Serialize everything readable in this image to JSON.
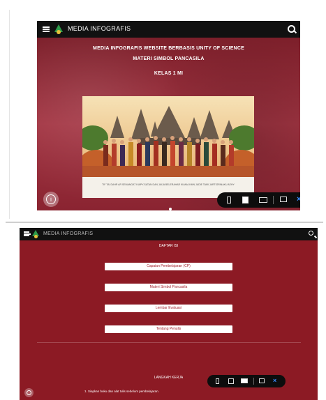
{
  "screen1": {
    "app_title": "MEDIA INFOGRAFIS",
    "headline_line1": "MEDIA INFOGRAFIS WEBSITE  BERBASIS UNITY OF SCIENCE",
    "headline_line2": "MATERI SIMBOL PANCASILA",
    "headline_line3": "KELAS 1 MI",
    "image_caption": "TIF TAI DAHR AR SEMANGAT KIAPY-SATAN DAN JAIJA BELERAHAR KIANIA KMN JADIE TAMI JARTIGRINAKU AEHY",
    "icons": {
      "menu": "hamburger-icon",
      "logo": "tree-logo-icon",
      "search": "search-icon",
      "info": "info-icon",
      "close": "close-icon"
    },
    "colors": {
      "background": "#8f2531",
      "topbar": "#111111",
      "close_accent": "#3b8cff"
    }
  },
  "screen2": {
    "app_title": "MEDIA INFOGRAFIS",
    "section_title": "DAFTAR ISI",
    "menu_items": [
      "Capaian Pembelajaran (CP)",
      "Materi Simbol Pancasila",
      "Lembar Evaluasi",
      "Tentang Penulis"
    ],
    "section2_title": "LANGKAH KERJA",
    "steps": [
      "1.  Siapkan buku dan alat tulis sebelum pembelajaran."
    ],
    "colors": {
      "background": "#8c1a24",
      "button_text": "#a2222e"
    }
  }
}
